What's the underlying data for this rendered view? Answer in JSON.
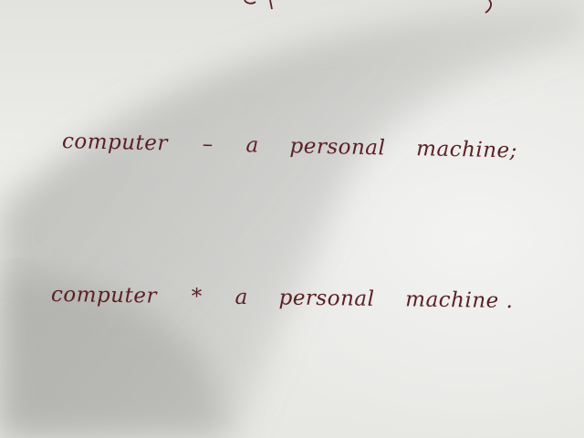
{
  "lines": [
    {
      "term": "computer",
      "separator": "–",
      "definition_article": "a",
      "definition_word1": "personal",
      "definition_word2": "machine",
      "end_punct": ";"
    },
    {
      "term": "computer",
      "separator": "*",
      "definition_article": "a",
      "definition_word1": "personal",
      "definition_word2": "machine",
      "end_punct": "."
    }
  ],
  "ink_color": "#5a1f22",
  "paper_color": "#ecece9"
}
